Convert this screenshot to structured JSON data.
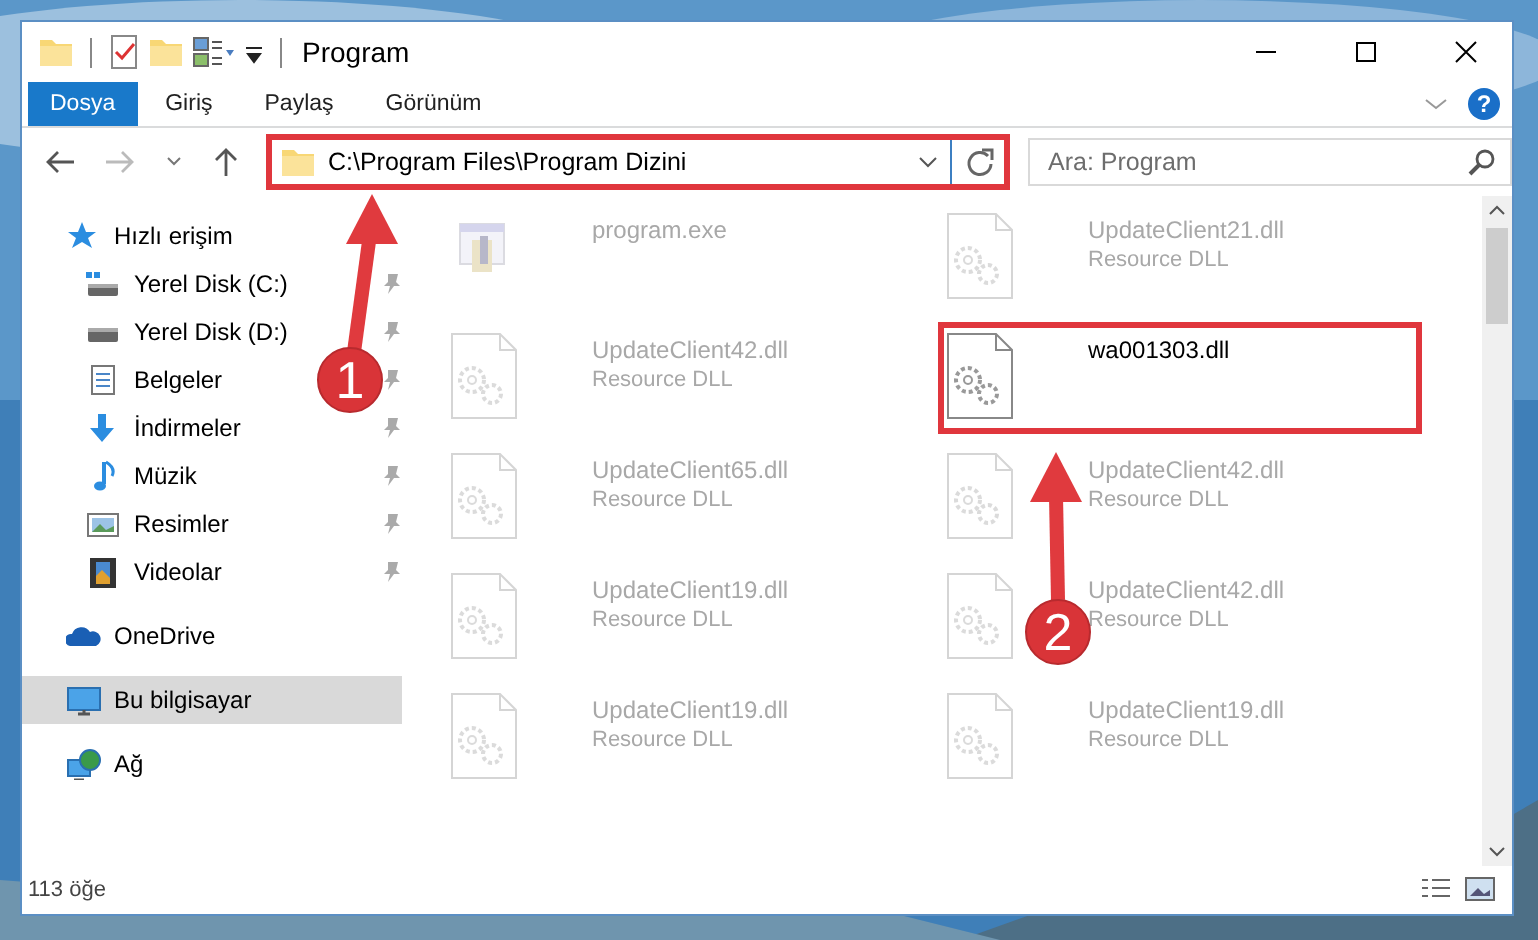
{
  "window": {
    "title": "Program"
  },
  "ribbon": {
    "tabs": [
      {
        "label": "Dosya",
        "kind": "file"
      },
      {
        "label": "Giriş",
        "kind": "tab"
      },
      {
        "label": "Paylaş",
        "kind": "tab"
      },
      {
        "label": "Görünüm",
        "kind": "tab"
      }
    ],
    "help": "?"
  },
  "address": {
    "path": "C:\\Program Files\\Program Dizini",
    "highlighted": true
  },
  "search": {
    "placeholder": "Ara: Program"
  },
  "sidebar": {
    "items": [
      {
        "label": "Hızlı erişim",
        "kind": "star",
        "selected": false,
        "children": [
          {
            "label": "Yerel Disk (C:)",
            "kind": "drive-windows",
            "selected": false,
            "pinned": true
          },
          {
            "label": "Yerel Disk (D:)",
            "kind": "drive",
            "selected": false,
            "pinned": true
          },
          {
            "label": "Belgeler",
            "kind": "document",
            "selected": false,
            "pinned": true
          },
          {
            "label": "İndirmeler",
            "kind": "download",
            "selected": false,
            "pinned": true
          },
          {
            "label": "Müzik",
            "kind": "music",
            "selected": false,
            "pinned": true
          },
          {
            "label": "Resimler",
            "kind": "pictures",
            "selected": false,
            "pinned": true
          },
          {
            "label": "Videolar",
            "kind": "video",
            "selected": false,
            "pinned": true
          }
        ]
      },
      {
        "label": "OneDrive",
        "kind": "cloud",
        "selected": false
      },
      {
        "label": "Bu bilgisayar",
        "kind": "computer",
        "selected": true
      },
      {
        "label": "Ağ",
        "kind": "network",
        "selected": false
      }
    ]
  },
  "files": [
    {
      "name": "program.exe",
      "kind": "exe",
      "faded": true,
      "highlighted": false
    },
    {
      "name": "UpdateClient21.dll",
      "subtitle": "Resource DLL",
      "kind": "dll",
      "faded": true,
      "highlighted": false
    },
    {
      "name": "UpdateClient42.dll",
      "subtitle": "Resource DLL",
      "kind": "dll",
      "faded": true,
      "highlighted": false
    },
    {
      "name": "wa001303.dll",
      "kind": "dll",
      "faded": false,
      "highlighted": true
    },
    {
      "name": "UpdateClient65.dll",
      "subtitle": "Resource DLL",
      "kind": "dll",
      "faded": true,
      "highlighted": false
    },
    {
      "name": "UpdateClient42.dll",
      "subtitle": "Resource DLL",
      "kind": "dll",
      "faded": true,
      "highlighted": false
    },
    {
      "name": "UpdateClient19.dll",
      "subtitle": "Resource DLL",
      "kind": "dll",
      "faded": true,
      "highlighted": false
    },
    {
      "name": "UpdateClient42.dll",
      "subtitle": "Resource DLL",
      "kind": "dll",
      "faded": true,
      "highlighted": false
    },
    {
      "name": "UpdateClient19.dll",
      "subtitle": "Resource DLL",
      "kind": "dll",
      "faded": true,
      "highlighted": false
    },
    {
      "name": "UpdateClient19.dll",
      "subtitle": "Resource DLL",
      "kind": "dll",
      "faded": true,
      "highlighted": false
    }
  ],
  "status_bar": {
    "count": "113 öğe"
  },
  "annotations": [
    {
      "number": "1"
    },
    {
      "number": "2"
    }
  ]
}
